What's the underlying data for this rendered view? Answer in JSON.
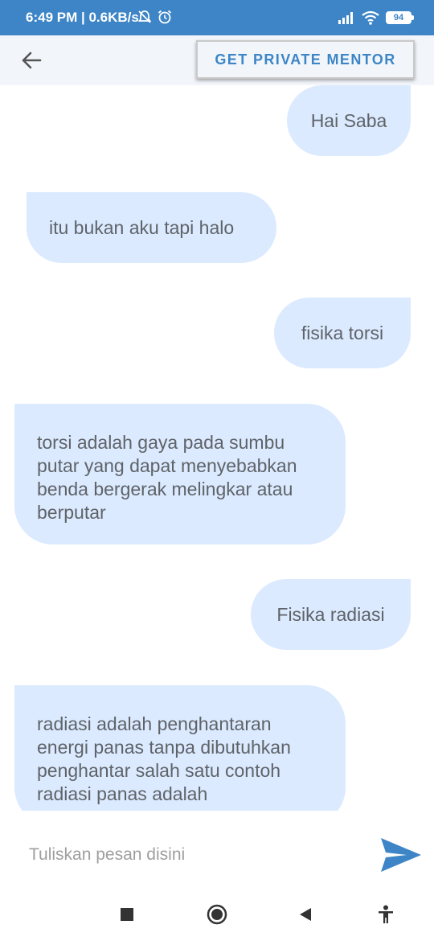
{
  "status_bar": {
    "time": "6:49 PM | 0.6KB/s",
    "battery": "94"
  },
  "header": {
    "mentor_button_label": "GET PRIVATE MENTOR"
  },
  "messages": [
    {
      "from": "me",
      "text": "Hai Saba"
    },
    {
      "from": "other",
      "text": "itu bukan aku tapi halo"
    },
    {
      "from": "me",
      "text": "fisika torsi"
    },
    {
      "from": "other",
      "text": "torsi adalah gaya pada sumbu putar yang dapat menyebabkan benda bergerak melingkar atau berputar"
    },
    {
      "from": "me",
      "text": "Fisika radiasi"
    },
    {
      "from": "other",
      "text": "radiasi adalah penghantaran energi panas tanpa dibutuhkan penghantar salah satu contoh radiasi panas adalah"
    }
  ],
  "composer": {
    "placeholder": "Tuliskan pesan disini",
    "value": ""
  },
  "colors": {
    "accent": "#3d85c6",
    "bubble": "#dbeaff",
    "header_bg": "#f2f6fb"
  }
}
